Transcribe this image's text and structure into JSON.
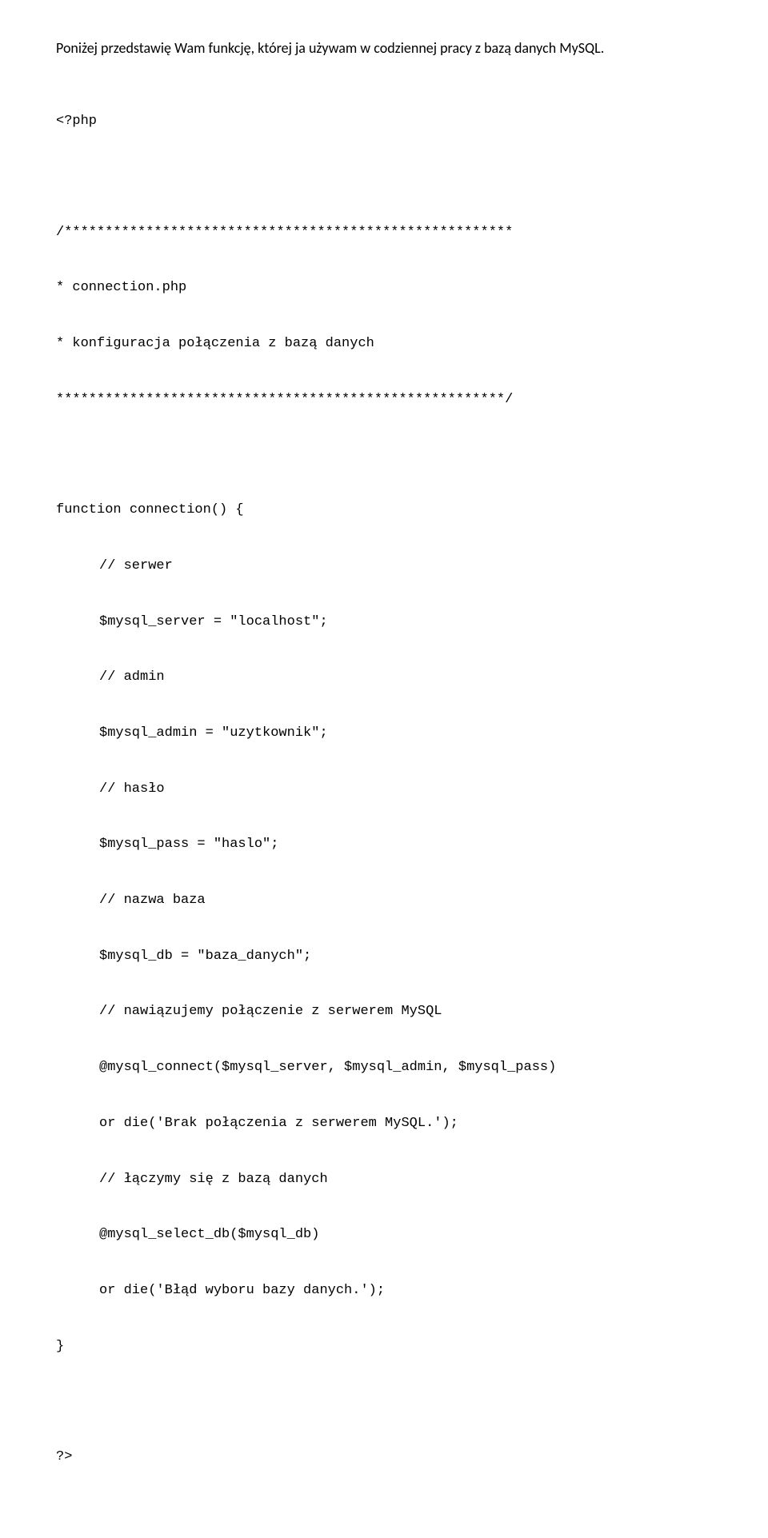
{
  "intro": "Poniżej przedstawię Wam funkcję, której ja używam w codziennej pracy z bazą danych MySQL.",
  "code": {
    "l1": "<?php",
    "l2": "/*******************************************************",
    "l3": "* connection.php",
    "l4": "* konfiguracja połączenia z bazą danych",
    "l5": "*******************************************************/",
    "l6": "function connection() {",
    "l7": "// serwer",
    "l8": "$mysql_server = \"localhost\";",
    "l9": "// admin",
    "l10": "$mysql_admin = \"uzytkownik\";",
    "l11": "// hasło",
    "l12": "$mysql_pass = \"haslo\";",
    "l13": "// nazwa baza",
    "l14": "$mysql_db = \"baza_danych\";",
    "l15": "// nawiązujemy połączenie z serwerem MySQL",
    "l16": "@mysql_connect($mysql_server, $mysql_admin, $mysql_pass)",
    "l17": "or die('Brak połączenia z serwerem MySQL.');",
    "l18": "// łączymy się z bazą danych",
    "l19": "@mysql_select_db($mysql_db)",
    "l20": "or die('Błąd wyboru bazy danych.');",
    "l21": "}",
    "l22": "?>"
  }
}
